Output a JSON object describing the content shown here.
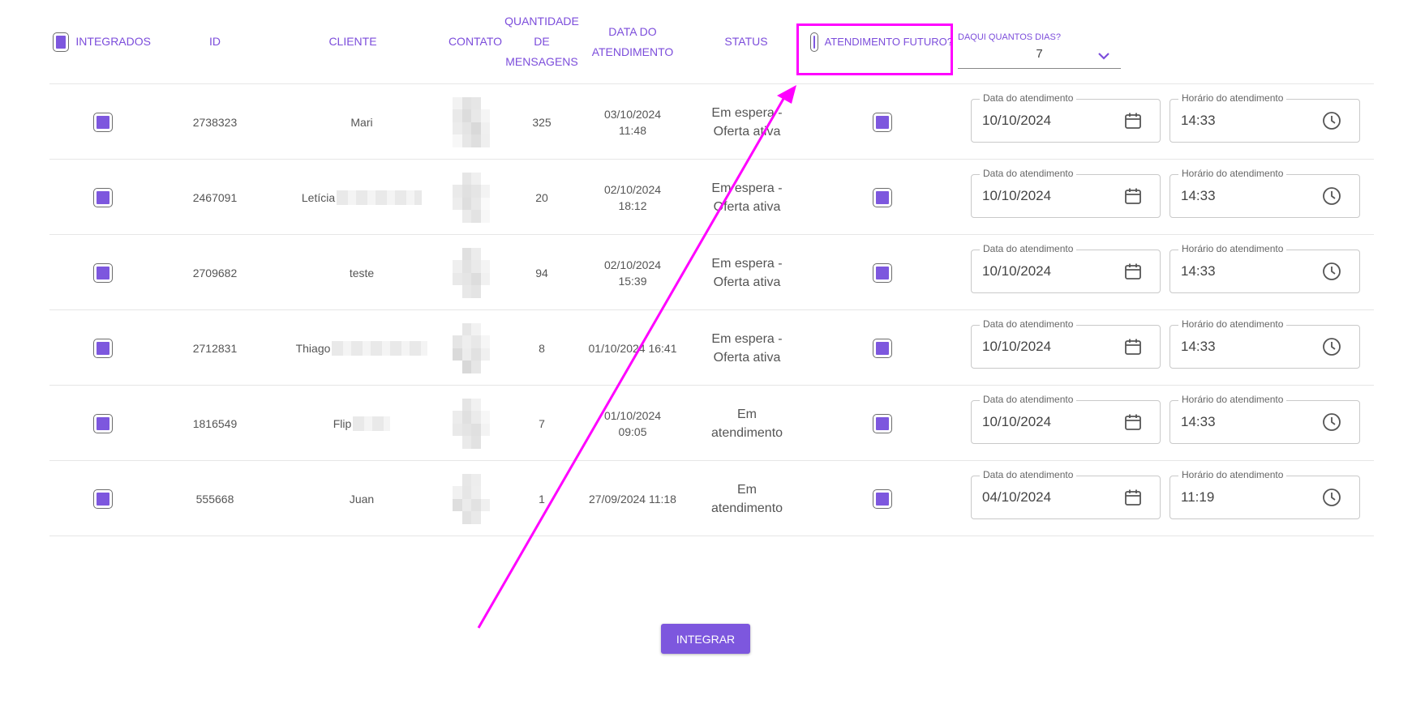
{
  "colors": {
    "accent": "#7d57de",
    "annotation": "#ff00ff"
  },
  "header": {
    "integrados": "INTEGRADOS",
    "id": "ID",
    "cliente": "CLIENTE",
    "contato": "CONTATO",
    "quantidade_1": "QUANTIDADE",
    "quantidade_2": "DE",
    "quantidade_3": "MENSAGENS",
    "data_1": "DATA DO",
    "data_2": "ATENDIMENTO",
    "status": "STATUS",
    "atendimento_futuro": "ATENDIMENTO FUTURO?",
    "daqui_quantos_dias_label": "DAQUI QUANTOS DIAS?",
    "daqui_quantos_dias_value": "7"
  },
  "field_labels": {
    "date": "Data do atendimento",
    "time": "Horário do atendimento"
  },
  "rows": [
    {
      "id": "2738323",
      "cliente": "Mari",
      "qtd": "325",
      "data_1": "03/10/2024",
      "data_2": "11:48",
      "status_1": "Em espera -",
      "status_2": "Oferta ativa",
      "date": "10/10/2024",
      "time": "14:33"
    },
    {
      "id": "2467091",
      "cliente": "Letícia",
      "qtd": "20",
      "data_1": "02/10/2024",
      "data_2": "18:12",
      "status_1": "Em espera -",
      "status_2": "Oferta ativa",
      "date": "10/10/2024",
      "time": "14:33"
    },
    {
      "id": "2709682",
      "cliente": "teste",
      "qtd": "94",
      "data_1": "02/10/2024",
      "data_2": "15:39",
      "status_1": "Em espera -",
      "status_2": "Oferta ativa",
      "date": "10/10/2024",
      "time": "14:33"
    },
    {
      "id": "2712831",
      "cliente": "Thiago",
      "qtd": "8",
      "data_1": "01/10/2024 16:41",
      "data_2": "",
      "status_1": "Em espera -",
      "status_2": "Oferta ativa",
      "date": "10/10/2024",
      "time": "14:33"
    },
    {
      "id": "1816549",
      "cliente": "Flip",
      "qtd": "7",
      "data_1": "01/10/2024",
      "data_2": "09:05",
      "status_1": "Em",
      "status_2": "atendimento",
      "date": "10/10/2024",
      "time": "14:33"
    },
    {
      "id": "555668",
      "cliente": "Juan",
      "qtd": "1",
      "data_1": "27/09/2024 11:18",
      "data_2": "",
      "status_1": "Em",
      "status_2": "atendimento",
      "date": "04/10/2024",
      "time": "11:19"
    }
  ],
  "button": {
    "integrar": "INTEGRAR"
  },
  "icons": {
    "date": "calendar-icon",
    "time": "clock-icon",
    "select": "chevron-down-icon"
  }
}
